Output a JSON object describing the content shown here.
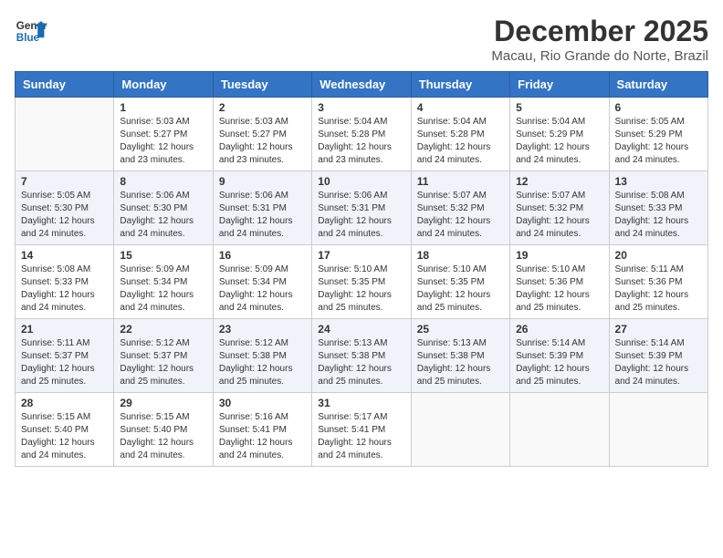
{
  "header": {
    "logo_line1": "General",
    "logo_line2": "Blue",
    "month": "December 2025",
    "location": "Macau, Rio Grande do Norte, Brazil"
  },
  "days_of_week": [
    "Sunday",
    "Monday",
    "Tuesday",
    "Wednesday",
    "Thursday",
    "Friday",
    "Saturday"
  ],
  "weeks": [
    [
      {
        "num": "",
        "detail": ""
      },
      {
        "num": "1",
        "detail": "Sunrise: 5:03 AM\nSunset: 5:27 PM\nDaylight: 12 hours\nand 23 minutes."
      },
      {
        "num": "2",
        "detail": "Sunrise: 5:03 AM\nSunset: 5:27 PM\nDaylight: 12 hours\nand 23 minutes."
      },
      {
        "num": "3",
        "detail": "Sunrise: 5:04 AM\nSunset: 5:28 PM\nDaylight: 12 hours\nand 23 minutes."
      },
      {
        "num": "4",
        "detail": "Sunrise: 5:04 AM\nSunset: 5:28 PM\nDaylight: 12 hours\nand 24 minutes."
      },
      {
        "num": "5",
        "detail": "Sunrise: 5:04 AM\nSunset: 5:29 PM\nDaylight: 12 hours\nand 24 minutes."
      },
      {
        "num": "6",
        "detail": "Sunrise: 5:05 AM\nSunset: 5:29 PM\nDaylight: 12 hours\nand 24 minutes."
      }
    ],
    [
      {
        "num": "7",
        "detail": "Sunrise: 5:05 AM\nSunset: 5:30 PM\nDaylight: 12 hours\nand 24 minutes."
      },
      {
        "num": "8",
        "detail": "Sunrise: 5:06 AM\nSunset: 5:30 PM\nDaylight: 12 hours\nand 24 minutes."
      },
      {
        "num": "9",
        "detail": "Sunrise: 5:06 AM\nSunset: 5:31 PM\nDaylight: 12 hours\nand 24 minutes."
      },
      {
        "num": "10",
        "detail": "Sunrise: 5:06 AM\nSunset: 5:31 PM\nDaylight: 12 hours\nand 24 minutes."
      },
      {
        "num": "11",
        "detail": "Sunrise: 5:07 AM\nSunset: 5:32 PM\nDaylight: 12 hours\nand 24 minutes."
      },
      {
        "num": "12",
        "detail": "Sunrise: 5:07 AM\nSunset: 5:32 PM\nDaylight: 12 hours\nand 24 minutes."
      },
      {
        "num": "13",
        "detail": "Sunrise: 5:08 AM\nSunset: 5:33 PM\nDaylight: 12 hours\nand 24 minutes."
      }
    ],
    [
      {
        "num": "14",
        "detail": "Sunrise: 5:08 AM\nSunset: 5:33 PM\nDaylight: 12 hours\nand 24 minutes."
      },
      {
        "num": "15",
        "detail": "Sunrise: 5:09 AM\nSunset: 5:34 PM\nDaylight: 12 hours\nand 24 minutes."
      },
      {
        "num": "16",
        "detail": "Sunrise: 5:09 AM\nSunset: 5:34 PM\nDaylight: 12 hours\nand 24 minutes."
      },
      {
        "num": "17",
        "detail": "Sunrise: 5:10 AM\nSunset: 5:35 PM\nDaylight: 12 hours\nand 25 minutes."
      },
      {
        "num": "18",
        "detail": "Sunrise: 5:10 AM\nSunset: 5:35 PM\nDaylight: 12 hours\nand 25 minutes."
      },
      {
        "num": "19",
        "detail": "Sunrise: 5:10 AM\nSunset: 5:36 PM\nDaylight: 12 hours\nand 25 minutes."
      },
      {
        "num": "20",
        "detail": "Sunrise: 5:11 AM\nSunset: 5:36 PM\nDaylight: 12 hours\nand 25 minutes."
      }
    ],
    [
      {
        "num": "21",
        "detail": "Sunrise: 5:11 AM\nSunset: 5:37 PM\nDaylight: 12 hours\nand 25 minutes."
      },
      {
        "num": "22",
        "detail": "Sunrise: 5:12 AM\nSunset: 5:37 PM\nDaylight: 12 hours\nand 25 minutes."
      },
      {
        "num": "23",
        "detail": "Sunrise: 5:12 AM\nSunset: 5:38 PM\nDaylight: 12 hours\nand 25 minutes."
      },
      {
        "num": "24",
        "detail": "Sunrise: 5:13 AM\nSunset: 5:38 PM\nDaylight: 12 hours\nand 25 minutes."
      },
      {
        "num": "25",
        "detail": "Sunrise: 5:13 AM\nSunset: 5:38 PM\nDaylight: 12 hours\nand 25 minutes."
      },
      {
        "num": "26",
        "detail": "Sunrise: 5:14 AM\nSunset: 5:39 PM\nDaylight: 12 hours\nand 25 minutes."
      },
      {
        "num": "27",
        "detail": "Sunrise: 5:14 AM\nSunset: 5:39 PM\nDaylight: 12 hours\nand 24 minutes."
      }
    ],
    [
      {
        "num": "28",
        "detail": "Sunrise: 5:15 AM\nSunset: 5:40 PM\nDaylight: 12 hours\nand 24 minutes."
      },
      {
        "num": "29",
        "detail": "Sunrise: 5:15 AM\nSunset: 5:40 PM\nDaylight: 12 hours\nand 24 minutes."
      },
      {
        "num": "30",
        "detail": "Sunrise: 5:16 AM\nSunset: 5:41 PM\nDaylight: 12 hours\nand 24 minutes."
      },
      {
        "num": "31",
        "detail": "Sunrise: 5:17 AM\nSunset: 5:41 PM\nDaylight: 12 hours\nand 24 minutes."
      },
      {
        "num": "",
        "detail": ""
      },
      {
        "num": "",
        "detail": ""
      },
      {
        "num": "",
        "detail": ""
      }
    ]
  ]
}
